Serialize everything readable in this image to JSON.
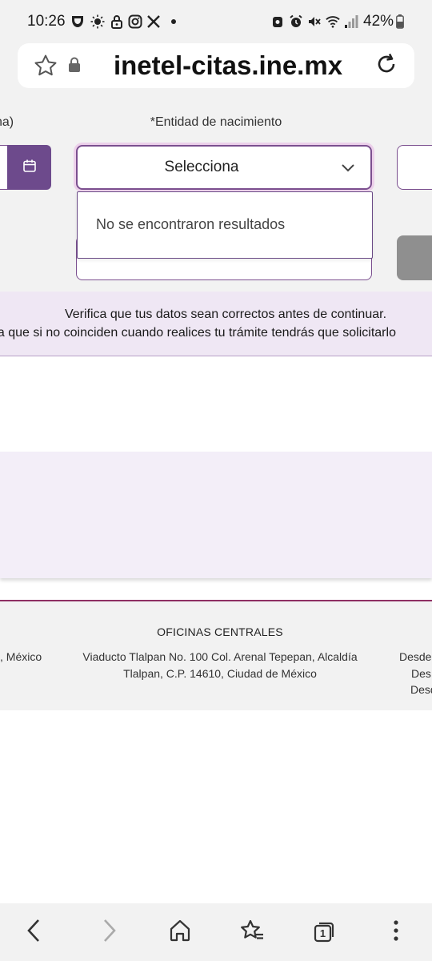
{
  "status_bar": {
    "time": "10:26",
    "battery": "42%",
    "left_icons": [
      "d-app-icon",
      "weather-icon",
      "lock-icon",
      "instagram-icon",
      "x-icon",
      "dot-icon"
    ],
    "right_icons": [
      "vpn-icon",
      "alarm-icon",
      "mute-icon",
      "wifi-icon",
      "signal-icon",
      "battery-icon"
    ]
  },
  "browser": {
    "url": "inetel-citas.ine.mx"
  },
  "form": {
    "left_label_fragment": "na)",
    "entidad_label": "*Entidad de nacimiento",
    "select_value": "Selecciona",
    "no_results": "No se encontraron resultados"
  },
  "notice": {
    "line1": "Verifica que tus datos sean correctos antes de continuar.",
    "line2": "da que si no coinciden cuando realices tu trámite tendrás que solicitarlo"
  },
  "footer": {
    "title": "OFICINAS CENTRALES",
    "left_fragment": ", México",
    "address_line1": "Viaducto Tlalpan No. 100 Col. Arenal Tepepan, Alcaldía",
    "address_line2": "Tlalpan, C.P. 14610, Ciudad de México",
    "right_line1": "Desde",
    "right_line2": "Des",
    "right_line3": "Desd"
  },
  "colors": {
    "accent_purple": "#6d4a8c",
    "border_purple": "#7b4f8f",
    "notice_bg": "#efe7f4",
    "footer_rule": "#8e2f62",
    "chrome_bg": "#f2f2f2"
  },
  "bottom_nav": {
    "tab_count": "1"
  }
}
